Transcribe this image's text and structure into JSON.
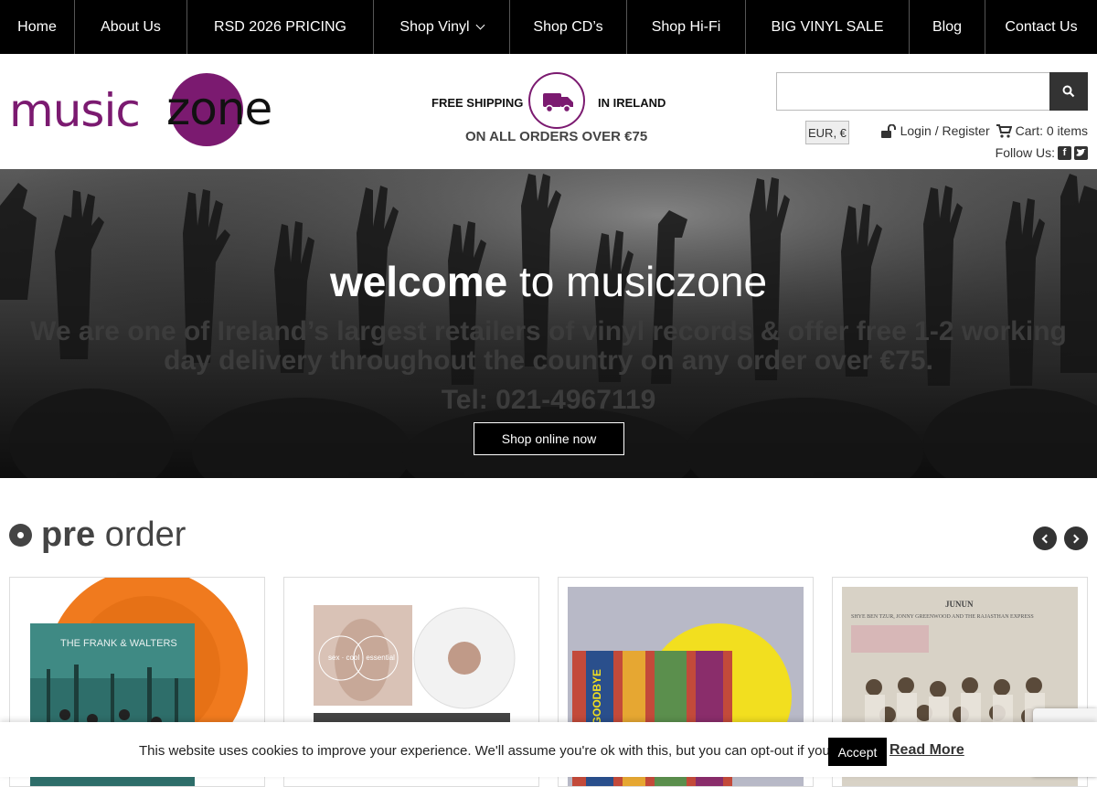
{
  "nav": {
    "items": [
      {
        "label": "Home"
      },
      {
        "label": "About Us"
      },
      {
        "label": "RSD 2026 PRICING"
      },
      {
        "label": "Shop Vinyl"
      },
      {
        "label": "Shop CD’s"
      },
      {
        "label": "Shop Hi-Fi"
      },
      {
        "label": "BIG VINYL SALE"
      },
      {
        "label": "Blog"
      },
      {
        "label": "Contact Us"
      }
    ]
  },
  "header": {
    "logo_music": "music",
    "logo_zone": "zone",
    "shipping_free": "FREE SHIPPING",
    "shipping_ireland": "IN IRELAND",
    "shipping_orders": "ON ALL ORDERS OVER €75",
    "search_value": "",
    "currency": "EUR, €",
    "login": "Login / Register",
    "cart": "Cart: 0 items",
    "follow": "Follow Us:"
  },
  "hero": {
    "title_bold": "welcome",
    "title_light": "to musiczone",
    "text": "We are one of Ireland’s largest retailers of vinyl records & offer free 1-2 working day delivery throughout the country on any order over €75.",
    "tel": "Tel: 021-4967119",
    "button": "Shop online now"
  },
  "preorder": {
    "title_bold": "pre",
    "title_light": "order",
    "cards": [
      {
        "cover_text": "THE FRANK & WALTERS",
        "sleeve_color": "#2e6e6a",
        "vinyl_color": "#f07a1e"
      },
      {
        "cover_text": "sex · cool · essential",
        "sleeve_color": "#d9c2b6",
        "vinyl_color": "#f2f2f2"
      },
      {
        "cover_text": "SONG GOODBYE",
        "sleeve_color": "#c34a3a",
        "vinyl_color": "#f2df1f"
      },
      {
        "cover_text": "JUNUN",
        "subtitle": "SHYE BEN TZUR, JONNY GREENWOOD AND THE RAJASTHAN EXPRESS",
        "sleeve_color": "#d8d2c6"
      }
    ]
  },
  "cookie": {
    "text": "This website uses cookies to improve your experience. We'll assume you're ok with this, but you can opt-out if you wish.",
    "accept": "Accept",
    "read_more": "Read More"
  },
  "colors": {
    "brand": "#7b1a70",
    "nav_bg": "#000000"
  }
}
